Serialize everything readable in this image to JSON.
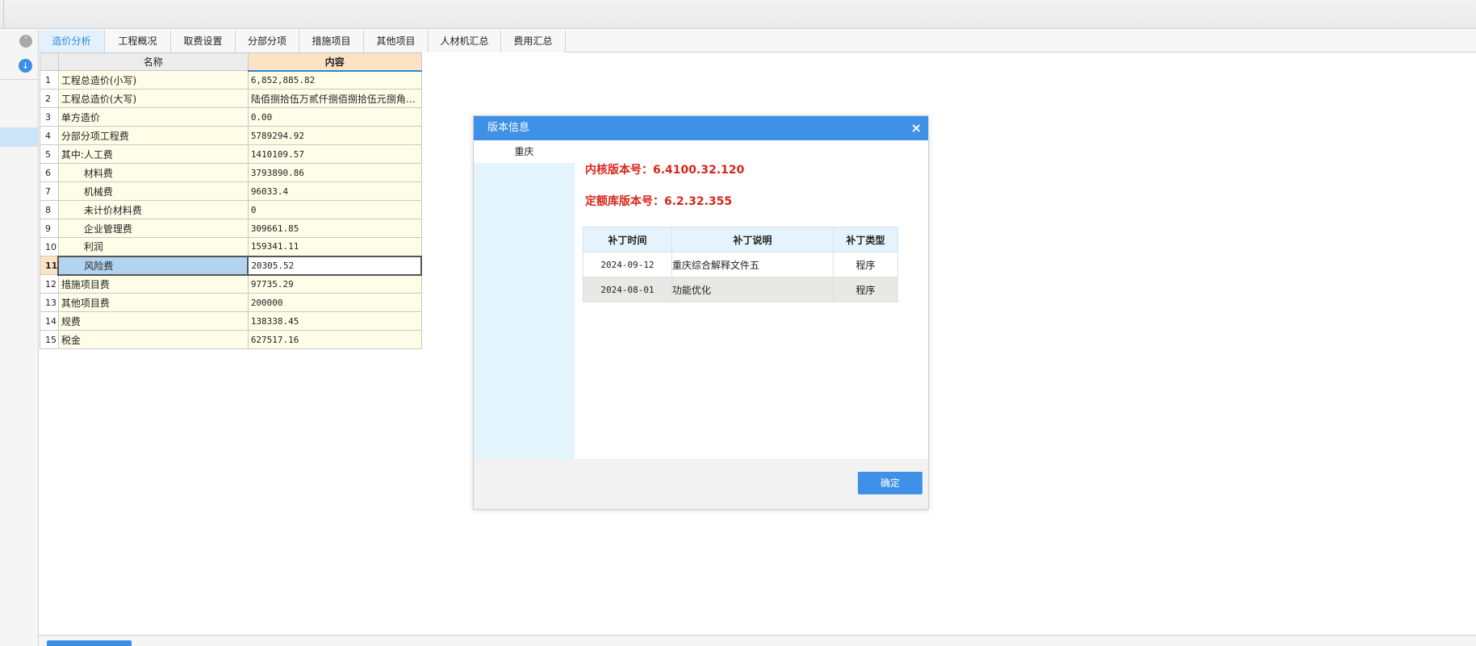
{
  "tabs": [
    {
      "label": "造价分析",
      "active": true
    },
    {
      "label": "工程概况",
      "active": false
    },
    {
      "label": "取费设置",
      "active": false
    },
    {
      "label": "分部分项",
      "active": false
    },
    {
      "label": "措施项目",
      "active": false
    },
    {
      "label": "其他项目",
      "active": false
    },
    {
      "label": "人材机汇总",
      "active": false
    },
    {
      "label": "费用汇总",
      "active": false
    }
  ],
  "grid": {
    "headers": {
      "name": "名称",
      "content": "内容"
    },
    "selected_row": 11,
    "rows": [
      {
        "num": "1",
        "name": "工程总造价(小写)",
        "value": "6,852,885.82"
      },
      {
        "num": "2",
        "name": "工程总造价(大写)",
        "value": "陆佰捌拾伍万贰仟捌佰捌拾伍元捌角…"
      },
      {
        "num": "3",
        "name": "单方造价",
        "value": "0.00"
      },
      {
        "num": "4",
        "name": "分部分项工程费",
        "value": "5789294.92"
      },
      {
        "num": "5",
        "name": "其中:人工费",
        "value": "1410109.57"
      },
      {
        "num": "6",
        "name": "材料费",
        "value": "3793890.86"
      },
      {
        "num": "7",
        "name": "机械费",
        "value": "96033.4"
      },
      {
        "num": "8",
        "name": "未计价材料费",
        "value": "0"
      },
      {
        "num": "9",
        "name": "企业管理费",
        "value": "309661.85"
      },
      {
        "num": "10",
        "name": "利润",
        "value": "159341.11"
      },
      {
        "num": "11",
        "name": "风险费",
        "value": "20305.52"
      },
      {
        "num": "12",
        "name": "措施项目费",
        "value": "97735.29"
      },
      {
        "num": "13",
        "name": "其他项目费",
        "value": "200000"
      },
      {
        "num": "14",
        "name": "规费",
        "value": "138338.45"
      },
      {
        "num": "15",
        "name": "税金",
        "value": "627517.16"
      }
    ]
  },
  "dialog": {
    "title": "版本信息",
    "close": "×",
    "left_item": "重庆",
    "kernel_version": "内核版本号：6.4100.32.120",
    "quota_version": "定额库版本号：6.2.32.355",
    "patch_headers": {
      "time": "补丁时间",
      "desc": "补丁说明",
      "type": "补丁类型"
    },
    "patches": [
      {
        "time": "2024-09-12",
        "desc": "重庆综合解释文件五",
        "type": "程序"
      },
      {
        "time": "2024-08-01",
        "desc": "功能优化",
        "type": "程序"
      }
    ],
    "ok_label": "确定"
  },
  "colors": {
    "accent": "#3e91e6",
    "version_red": "#d8261b",
    "grid_cell": "#fffde8",
    "selected": "#b3d4f0"
  }
}
